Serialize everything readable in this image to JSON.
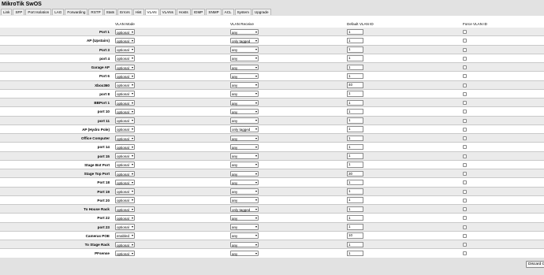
{
  "app": {
    "title": "MikroTik SwOS"
  },
  "tabs": [
    {
      "label": "Link"
    },
    {
      "label": "SFP"
    },
    {
      "label": "Port Isolation"
    },
    {
      "label": "LAG"
    },
    {
      "label": "Forwarding"
    },
    {
      "label": "RSTP"
    },
    {
      "label": "Stats"
    },
    {
      "label": "Errors"
    },
    {
      "label": "Hist"
    },
    {
      "label": "VLAN",
      "active": true
    },
    {
      "label": "VLANs"
    },
    {
      "label": "Hosts"
    },
    {
      "label": "IGMP"
    },
    {
      "label": "SNMP"
    },
    {
      "label": "ACL"
    },
    {
      "label": "System"
    },
    {
      "label": "Upgrade"
    }
  ],
  "columns": {
    "mode": "VLAN Mode",
    "receive": "VLAN Receive",
    "default_id": "Default VLAN ID",
    "force": "Force VLAN ID"
  },
  "ports": [
    {
      "name": "Port 1",
      "mode": "optional",
      "receive": "any",
      "vlan": "1",
      "force": false
    },
    {
      "name": "AP (Upstairs)",
      "mode": "optional",
      "receive": "only tagged",
      "vlan": "1",
      "force": false
    },
    {
      "name": "Port 3",
      "mode": "optional",
      "receive": "any",
      "vlan": "1",
      "force": false
    },
    {
      "name": "port 4",
      "mode": "optional",
      "receive": "any",
      "vlan": "1",
      "force": false
    },
    {
      "name": "Garage AP",
      "mode": "optional",
      "receive": "any",
      "vlan": "1",
      "force": false
    },
    {
      "name": "Port 6",
      "mode": "optional",
      "receive": "any",
      "vlan": "1",
      "force": false
    },
    {
      "name": "Xbox360",
      "mode": "optional",
      "receive": "any",
      "vlan": "40",
      "force": false
    },
    {
      "name": "port 8",
      "mode": "optional",
      "receive": "any",
      "vlan": "1",
      "force": false
    },
    {
      "name": "BBPort 1",
      "mode": "optional",
      "receive": "any",
      "vlan": "1",
      "force": false
    },
    {
      "name": "port 10",
      "mode": "optional",
      "receive": "any",
      "vlan": "1",
      "force": false
    },
    {
      "name": "port 11",
      "mode": "optional",
      "receive": "any",
      "vlan": "1",
      "force": false
    },
    {
      "name": "AP (Hydro Pole)",
      "mode": "optional",
      "receive": "only tagged",
      "vlan": "1",
      "force": false
    },
    {
      "name": "Office Computer",
      "mode": "optional",
      "receive": "any",
      "vlan": "1",
      "force": false
    },
    {
      "name": "port 14",
      "mode": "optional",
      "receive": "any",
      "vlan": "1",
      "force": false
    },
    {
      "name": "port 15",
      "mode": "optional",
      "receive": "any",
      "vlan": "1",
      "force": false
    },
    {
      "name": "Stage Bot Port",
      "mode": "optional",
      "receive": "any",
      "vlan": "1",
      "force": false
    },
    {
      "name": "Stage Top Port",
      "mode": "optional",
      "receive": "any",
      "vlan": "30",
      "force": false
    },
    {
      "name": "Port 18",
      "mode": "optional",
      "receive": "any",
      "vlan": "1",
      "force": false
    },
    {
      "name": "Port 19",
      "mode": "optional",
      "receive": "any",
      "vlan": "1",
      "force": false
    },
    {
      "name": "Port 20",
      "mode": "optional",
      "receive": "any",
      "vlan": "1",
      "force": false
    },
    {
      "name": "To House Rack",
      "mode": "optional",
      "receive": "only tagged",
      "vlan": "1",
      "force": false
    },
    {
      "name": "Port 22",
      "mode": "optional",
      "receive": "any",
      "vlan": "1",
      "force": false
    },
    {
      "name": "port 23",
      "mode": "optional",
      "receive": "any",
      "vlan": "1",
      "force": false
    },
    {
      "name": "Cameras POE",
      "mode": "enabled",
      "receive": "any",
      "vlan": "10",
      "force": false
    },
    {
      "name": "To Stage Rack",
      "mode": "optional",
      "receive": "any",
      "vlan": "1",
      "force": false
    },
    {
      "name": "PFsense",
      "mode": "optional",
      "receive": "any",
      "vlan": "1",
      "force": false
    }
  ],
  "footer": {
    "discard_label": "Discard Changes"
  },
  "icons": {
    "select_arrow": "chevron-down-icon"
  },
  "colors": {
    "header_bg": "#e2e2e2",
    "row_alt": "#ebebeb"
  }
}
